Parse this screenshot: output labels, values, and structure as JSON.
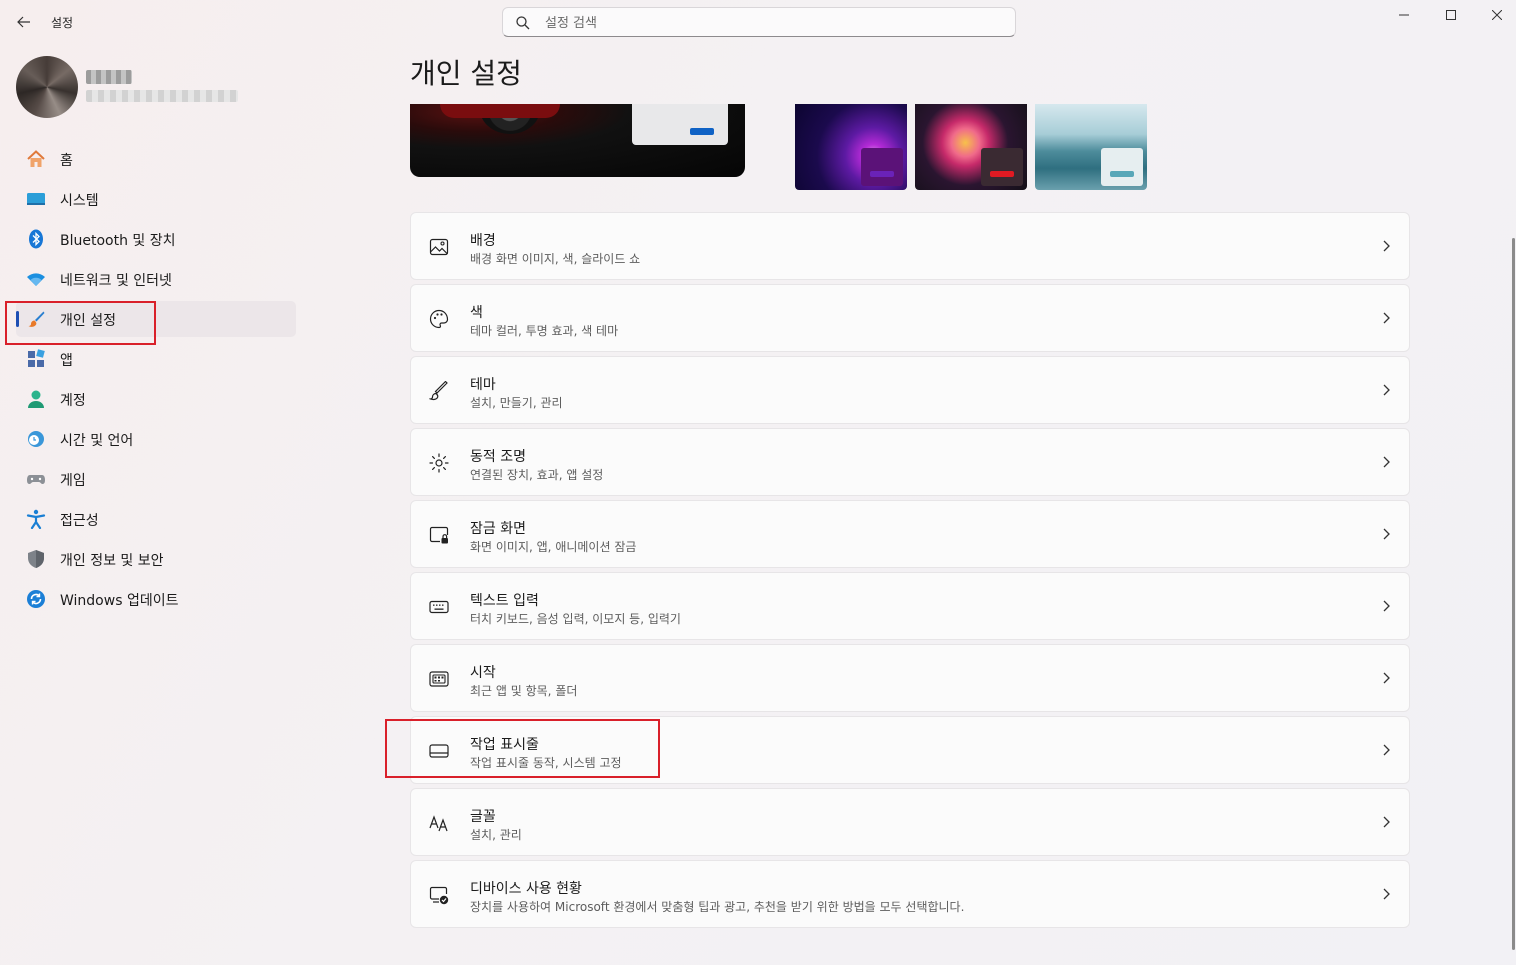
{
  "window": {
    "app_title": "설정",
    "search_placeholder": "설정 검색"
  },
  "sidebar": {
    "items": [
      {
        "label": "홈",
        "icon": "home-icon"
      },
      {
        "label": "시스템",
        "icon": "system-icon"
      },
      {
        "label": "Bluetooth 및 장치",
        "icon": "bluetooth-icon"
      },
      {
        "label": "네트워크 및 인터넷",
        "icon": "wifi-icon"
      },
      {
        "label": "개인 설정",
        "icon": "brush-icon",
        "selected": true
      },
      {
        "label": "앱",
        "icon": "apps-icon"
      },
      {
        "label": "계정",
        "icon": "account-icon"
      },
      {
        "label": "시간 및 언어",
        "icon": "time-language-icon"
      },
      {
        "label": "게임",
        "icon": "gamepad-icon"
      },
      {
        "label": "접근성",
        "icon": "accessibility-icon"
      },
      {
        "label": "개인 정보 및 보안",
        "icon": "shield-icon"
      },
      {
        "label": "Windows 업데이트",
        "icon": "update-icon"
      }
    ]
  },
  "main": {
    "title": "개인 설정",
    "settings": [
      {
        "title": "배경",
        "desc": "배경 화면 이미지, 색, 슬라이드 쇼",
        "icon": "image-icon"
      },
      {
        "title": "색",
        "desc": "테마 컬러, 투명 효과, 색 테마",
        "icon": "palette-icon"
      },
      {
        "title": "테마",
        "desc": "설치, 만들기, 관리",
        "icon": "brush-icon"
      },
      {
        "title": "동적 조명",
        "desc": "연결된 장치, 효과, 앱 설정",
        "icon": "dynamic-lighting-icon"
      },
      {
        "title": "잠금 화면",
        "desc": "화면 이미지, 앱, 애니메이션 잠금",
        "icon": "lock-screen-icon"
      },
      {
        "title": "텍스트 입력",
        "desc": "터치 키보드, 음성 입력, 이모지 등, 입력기",
        "icon": "keyboard-icon"
      },
      {
        "title": "시작",
        "desc": "최근 앱 및 항목, 폴더",
        "icon": "start-icon"
      },
      {
        "title": "작업 표시줄",
        "desc": "작업 표시줄 동작, 시스템 고정",
        "icon": "taskbar-icon"
      },
      {
        "title": "글꼴",
        "desc": "설치, 관리",
        "icon": "font-icon"
      },
      {
        "title": "디바이스 사용 현황",
        "desc": "장치를 사용하여 Microsoft 환경에서 맞춤형 팁과 광고, 추천을 받기 위한 방법을 모두 선택합니다.",
        "icon": "device-usage-icon"
      }
    ]
  },
  "colors": {
    "accent": "#1e4fb3",
    "highlight": "#d9202a"
  }
}
